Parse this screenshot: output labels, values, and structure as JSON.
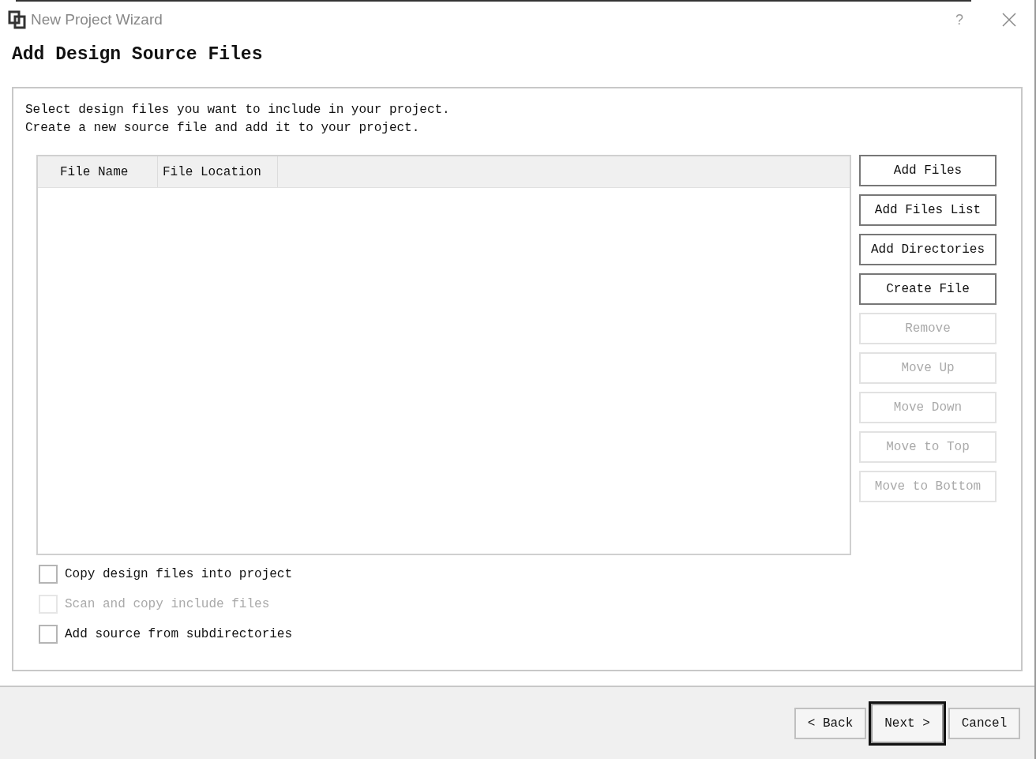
{
  "window": {
    "title": "New Project Wizard",
    "help": "?"
  },
  "heading": "Add Design Source Files",
  "instructions": [
    "Select design files you want to include in your project.",
    "Create a new source file and add it to your project."
  ],
  "table": {
    "columns": [
      "File Name",
      "File Location"
    ]
  },
  "side_buttons": [
    {
      "label": "Add Files",
      "disabled": false
    },
    {
      "label": "Add Files List",
      "disabled": false
    },
    {
      "label": "Add Directories",
      "disabled": false
    },
    {
      "label": "Create File",
      "disabled": false
    },
    {
      "label": "Remove",
      "disabled": true
    },
    {
      "label": "Move Up",
      "disabled": true
    },
    {
      "label": "Move Down",
      "disabled": true
    },
    {
      "label": "Move to Top",
      "disabled": true
    },
    {
      "label": "Move to Bottom",
      "disabled": true
    }
  ],
  "options": [
    {
      "label": "Copy design files into project",
      "checked": false,
      "disabled": false
    },
    {
      "label": "Scan and copy include files",
      "checked": false,
      "disabled": true
    },
    {
      "label": "Add source from subdirectories",
      "checked": false,
      "disabled": false
    }
  ],
  "footer_buttons": [
    {
      "label": "< Back",
      "focused": false
    },
    {
      "label": "Next >",
      "focused": true
    },
    {
      "label": "Cancel",
      "focused": false
    }
  ]
}
